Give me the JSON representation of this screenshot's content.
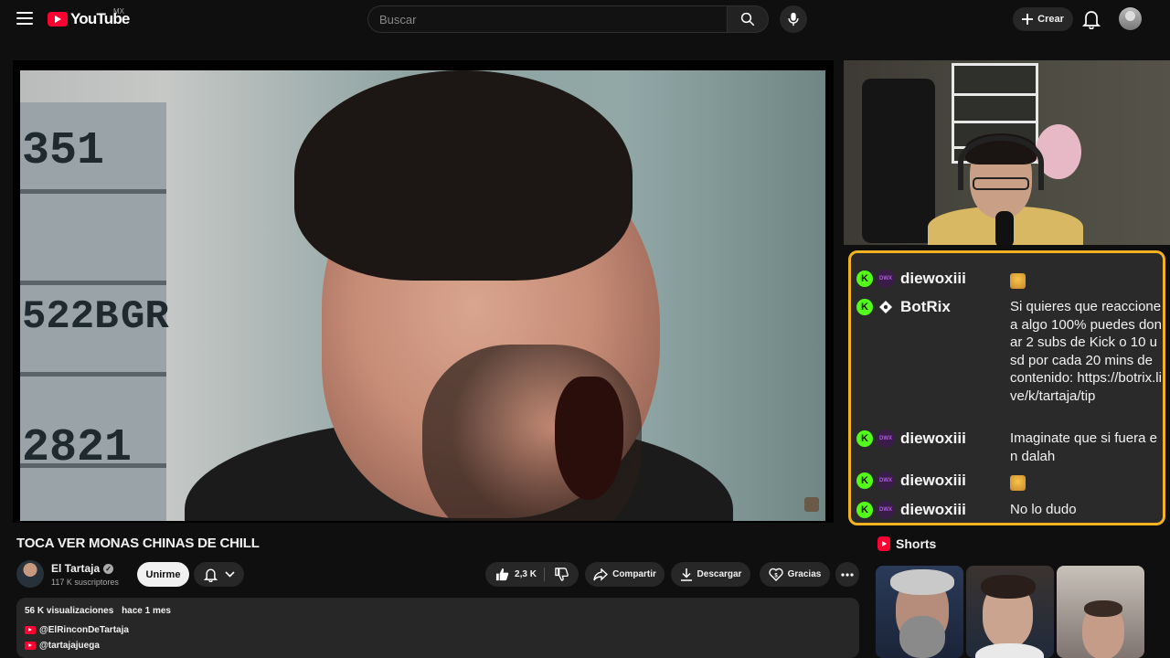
{
  "header": {
    "logo_text": "YouTube",
    "country_code": "MX",
    "search_placeholder": "Buscar",
    "create_label": "Crear"
  },
  "video": {
    "plate_texts": [
      "351",
      "522B",
      "GR",
      "2821"
    ],
    "title": "TOCA VER MONAS CHINAS DE CHILL"
  },
  "channel": {
    "name": "El Tartaja",
    "subscribers": "117 K suscriptores",
    "join_label": "Unirme"
  },
  "actions": {
    "likes": "2,3 K",
    "share_label": "Compartir",
    "download_label": "Descargar",
    "thanks_label": "Gracias"
  },
  "description": {
    "views": "56 K visualizaciones",
    "date": "hace 1 mes",
    "links": [
      "@ElRinconDeTartaja",
      "@tartajajuega"
    ]
  },
  "chat": {
    "messages": [
      {
        "user": "diewoxiii",
        "text": "",
        "emote": true,
        "bot": false
      },
      {
        "user": "BotRix",
        "text": "Si quieres que reaccione a algo 100% puedes donar 2 subs de Kick o 10 usd por cada 20 mins de contenido: https://botrix.live/k/tartaja/tip",
        "emote": false,
        "bot": true
      },
      {
        "user": "diewoxiii",
        "text": "Imaginate que si fuera en dalah",
        "emote": false,
        "bot": false
      },
      {
        "user": "diewoxiii",
        "text": "",
        "emote": true,
        "bot": false
      },
      {
        "user": "diewoxiii",
        "text": "No lo dudo",
        "emote": false,
        "bot": false
      }
    ]
  },
  "shorts": {
    "heading": "Shorts"
  },
  "colors": {
    "brand_red": "#ff0033",
    "kick_green": "#53fc18",
    "chat_border": "#f3b221"
  }
}
